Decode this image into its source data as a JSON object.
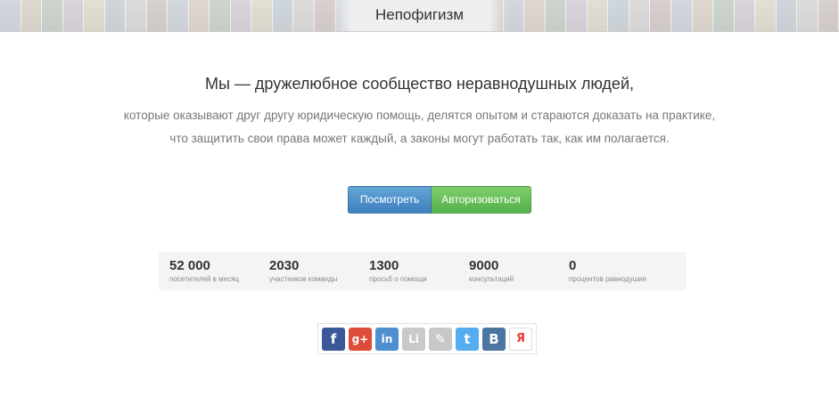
{
  "header": {
    "site_title": "Непофигизм"
  },
  "hero": {
    "headline": "Мы — дружелюбное сообщество неравнодушных людей,",
    "line1": "которые оказывают друг другу юридическую помощь, делятся опытом и стараются доказать на практике,",
    "line2": "что защитить свои права может каждый, а законы могут работать так, как им полагается."
  },
  "actions": {
    "view_label": "Посмотреть",
    "auth_label": "Авторизоваться"
  },
  "stats": [
    {
      "value": "52 000",
      "label": "посетителей в месяц"
    },
    {
      "value": "2030",
      "label": "участников команды"
    },
    {
      "value": "1300",
      "label": "просьб о помощи"
    },
    {
      "value": "9000",
      "label": "консультаций"
    },
    {
      "value": "0",
      "label": "процентов равнодушия"
    }
  ],
  "share": {
    "icons": [
      {
        "name": "facebook-icon",
        "glyph": "f",
        "color": "#3b5998"
      },
      {
        "name": "google-plus-icon",
        "glyph": "g+",
        "color": "#dd4b39"
      },
      {
        "name": "linkedin-icon",
        "glyph": "in",
        "color": "#4f8fcf"
      },
      {
        "name": "livejournal-icon",
        "glyph": "Li",
        "color": "#c9c9c9"
      },
      {
        "name": "pen-icon",
        "glyph": "✎",
        "color": "#c8c8c8"
      },
      {
        "name": "twitter-icon",
        "glyph": "t",
        "color": "#55acee"
      },
      {
        "name": "vkontakte-icon",
        "glyph": "В",
        "color": "#4c75a3"
      },
      {
        "name": "yandex-icon",
        "glyph": "Я",
        "color": "#e53b3b"
      }
    ]
  }
}
